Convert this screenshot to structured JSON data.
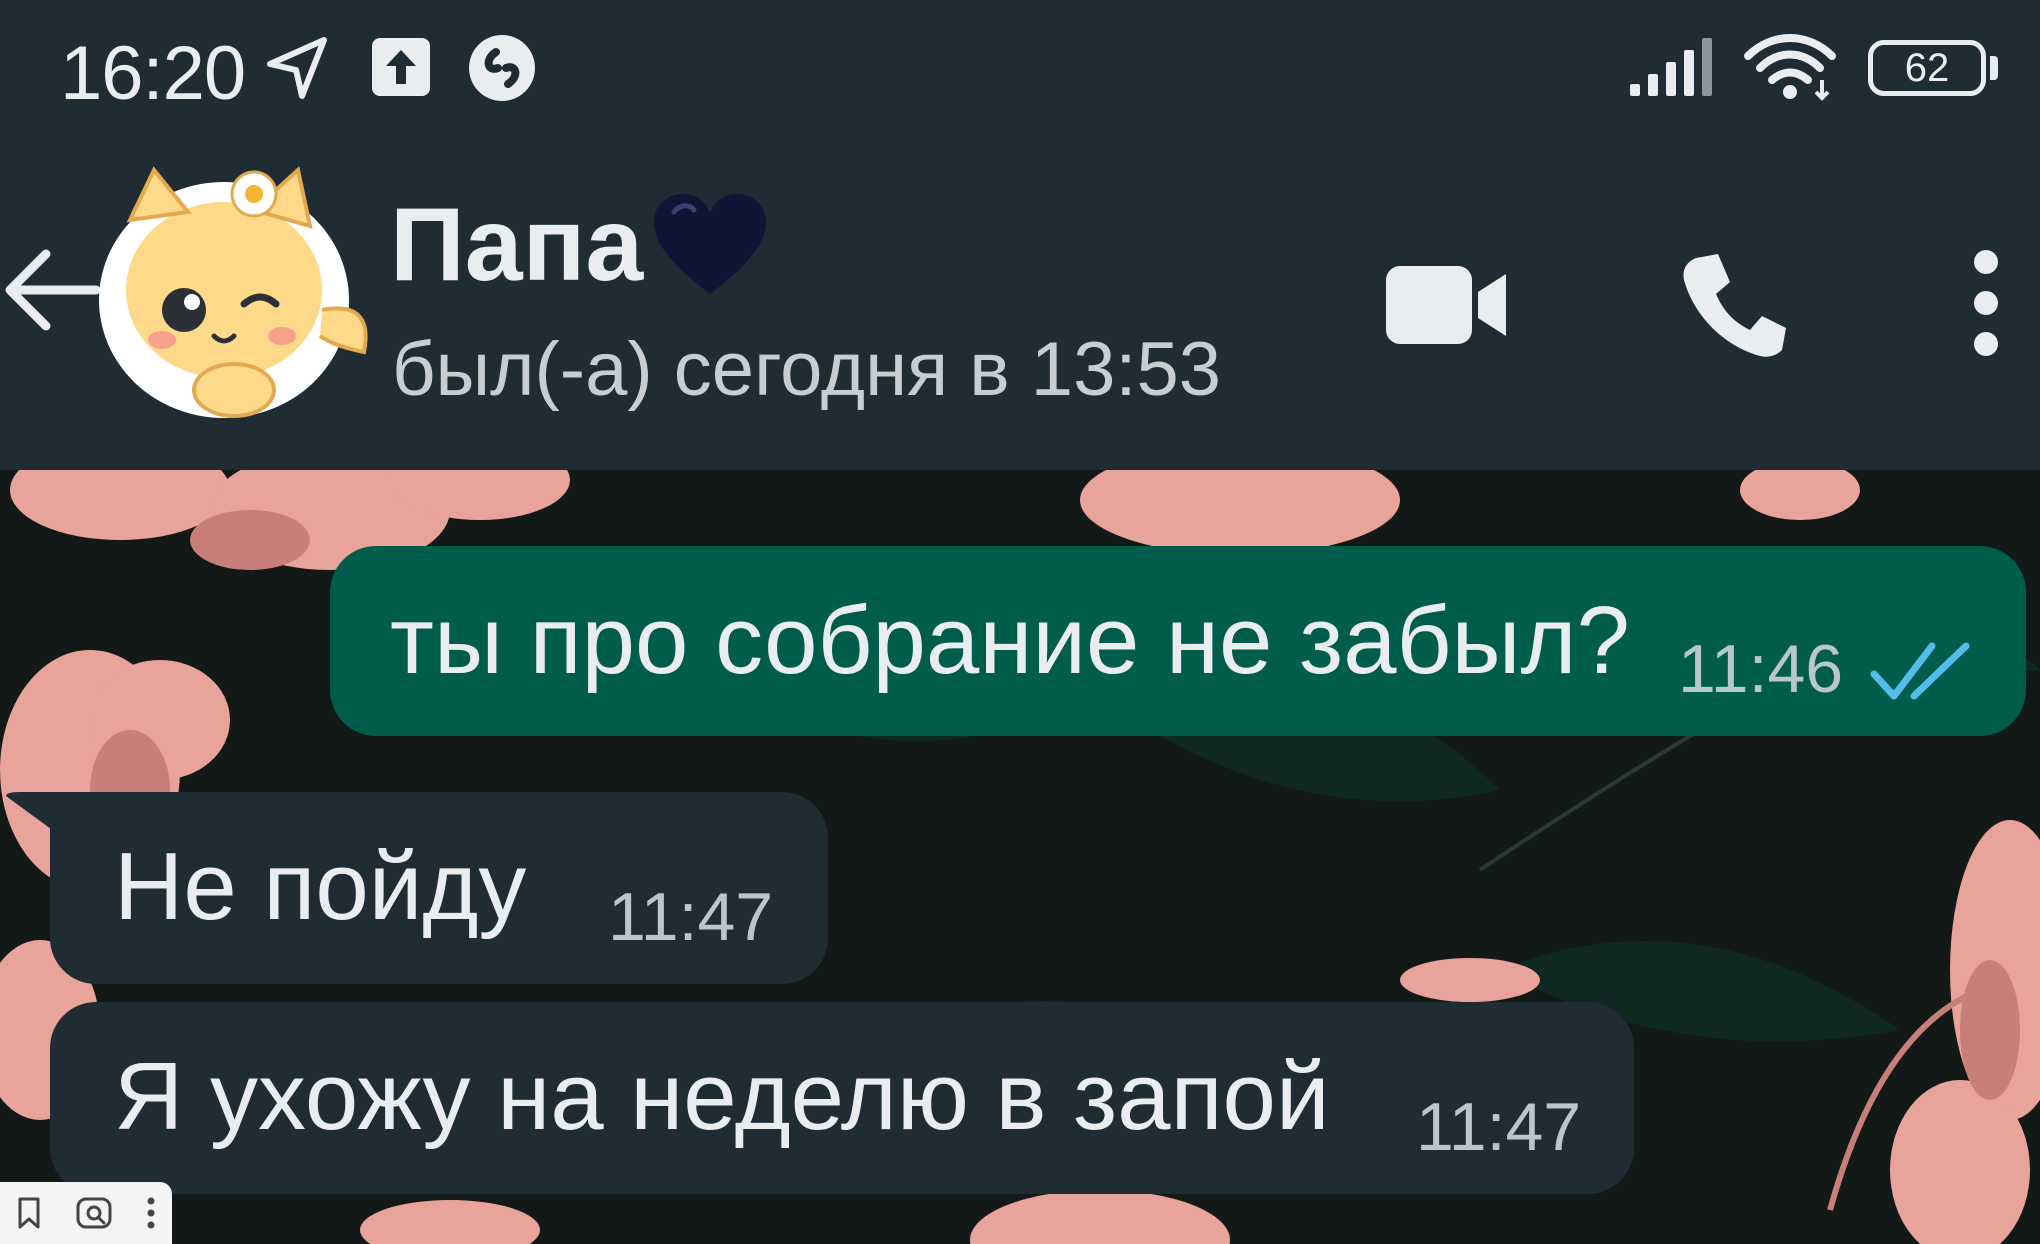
{
  "status_bar": {
    "time": "16:20",
    "battery_level": "62",
    "icons": [
      "navigation-arrow-icon",
      "upload-icon",
      "shazam-icon",
      "signal-icon",
      "wifi-icon",
      "battery-icon"
    ]
  },
  "header": {
    "contact_name": "Папа",
    "contact_emoji": "🖤",
    "last_seen": "был(-а) сегодня в 13:53",
    "icons": [
      "back-arrow-icon",
      "avatar-sticker",
      "video-call-icon",
      "voice-call-icon",
      "more-options-icon"
    ]
  },
  "messages": [
    {
      "direction": "outgoing",
      "text": "ты про собрание не забыл?",
      "time": "11:46",
      "status": "read"
    },
    {
      "direction": "incoming",
      "text": "Не пойду",
      "time": "11:47"
    },
    {
      "direction": "incoming",
      "text": "Я ухожу на неделю в запой",
      "time": "11:47"
    }
  ],
  "colors": {
    "header_bg": "#1f2c34",
    "outgoing_bubble": "#005c4b",
    "incoming_bubble": "#1f2c34",
    "read_ticks": "#53bdeb",
    "wallpaper_flowers": "#e8a39a"
  },
  "overlay_toolbar": {
    "icons": [
      "bookmark-icon",
      "lens-search-icon",
      "more-vert-icon"
    ]
  }
}
